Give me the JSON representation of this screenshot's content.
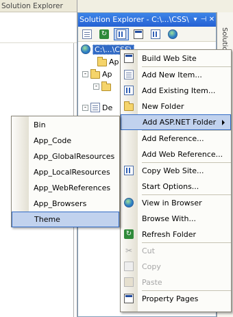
{
  "left_window": {
    "title": "Solution Explorer"
  },
  "solution_explorer": {
    "title": "Solution Explorer - C:\\...\\CSS\\",
    "title_buttons": [
      "▾",
      "⊣",
      "✕"
    ],
    "toolbar_icons": [
      "properties-icon",
      "refresh-icon",
      "nest-files-icon",
      "view-code-icon",
      "copy-website-icon",
      "asp-config-icon"
    ],
    "tree": [
      {
        "label": "C:\\...\\CSS\\",
        "icon": "website-icon",
        "expander": "",
        "selected": true
      },
      {
        "label": "Ap",
        "icon": "folder-icon",
        "expander": ""
      },
      {
        "label": "Ap",
        "icon": "folder-icon",
        "expander": "-"
      },
      {
        "label": "",
        "icon": "folder-icon",
        "expander": "-"
      },
      {
        "label": "De",
        "icon": "page-icon",
        "expander": "-"
      }
    ]
  },
  "side_strip": {
    "label": "Solutio"
  },
  "context_menu": {
    "items": [
      {
        "label": "Build Web Site",
        "icon": "build-icon"
      },
      {
        "sep": true
      },
      {
        "label": "Add New Item...",
        "icon": "add-new-item-icon"
      },
      {
        "label": "Add Existing Item...",
        "icon": "add-existing-item-icon"
      },
      {
        "label": "New Folder",
        "icon": "new-folder-icon"
      },
      {
        "label": "Add ASP.NET Folder",
        "icon": "",
        "highlighted": true,
        "submenu": true
      },
      {
        "sep": true
      },
      {
        "label": "Add Reference...",
        "icon": ""
      },
      {
        "label": "Add Web Reference...",
        "icon": ""
      },
      {
        "sep": true
      },
      {
        "label": "Copy Web Site...",
        "icon": "copy-website-icon"
      },
      {
        "label": "Start Options...",
        "icon": ""
      },
      {
        "sep": true
      },
      {
        "label": "View in Browser",
        "icon": "view-in-browser-icon"
      },
      {
        "label": "Browse With...",
        "icon": ""
      },
      {
        "label": "Refresh Folder",
        "icon": "refresh-icon"
      },
      {
        "sep": true
      },
      {
        "label": "Cut",
        "icon": "cut-icon",
        "disabled": true
      },
      {
        "label": "Copy",
        "icon": "copy-icon",
        "disabled": true
      },
      {
        "label": "Paste",
        "icon": "paste-icon",
        "disabled": true
      },
      {
        "sep": true
      },
      {
        "label": "Property Pages",
        "icon": "property-pages-icon"
      }
    ]
  },
  "asp_net_submenu": {
    "items": [
      {
        "label": "Bin"
      },
      {
        "label": "App_Code"
      },
      {
        "label": "App_GlobalResources"
      },
      {
        "label": "App_LocalResources"
      },
      {
        "label": "App_WebReferences"
      },
      {
        "label": "App_Browsers"
      },
      {
        "label": "Theme",
        "highlighted": true
      }
    ]
  },
  "colors": {
    "highlight": "#c1d2ee",
    "highlight_border": "#316ac5",
    "titlebar": "#2561d3"
  }
}
